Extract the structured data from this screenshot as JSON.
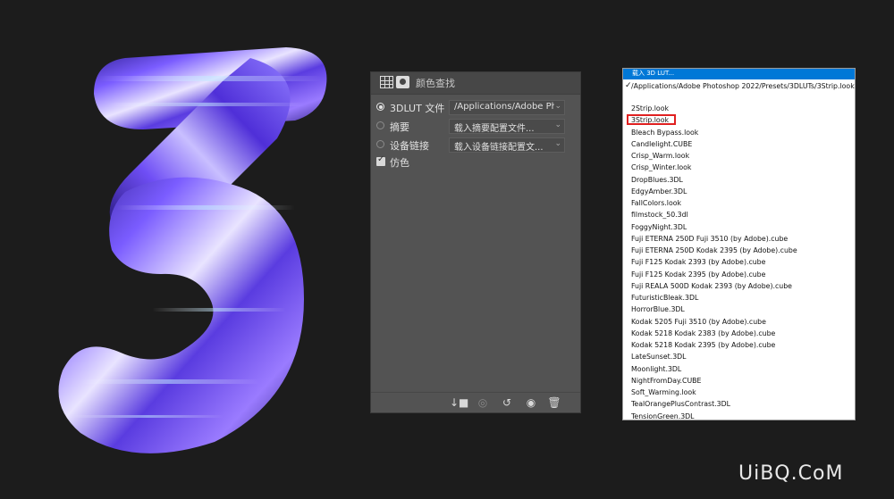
{
  "panel": {
    "title": "颜色查找",
    "rows": [
      {
        "label": "3DLUT 文件",
        "value": "/Applications/Adobe  Pho...",
        "selected": true
      },
      {
        "label": "摘要",
        "value": "载入摘要配置文件...",
        "selected": false
      },
      {
        "label": "设备链接",
        "value": "载入设备链接配置文...",
        "selected": false
      }
    ],
    "dither_label": "仿色",
    "dither_checked": true
  },
  "dropdown": {
    "selected_header": "载入 3D LUT...",
    "current_path": "/Applications/Adobe Photoshop 2022/Presets/3DLUTs/3Strip.look",
    "items": [
      "2Strip.look",
      "3Strip.look",
      "Bleach Bypass.look",
      "Candlelight.CUBE",
      "Crisp_Warm.look",
      "Crisp_Winter.look",
      "DropBlues.3DL",
      "EdgyAmber.3DL",
      "FallColors.look",
      "filmstock_50.3dl",
      "FoggyNight.3DL",
      "Fuji ETERNA 250D Fuji 3510 (by Adobe).cube",
      "Fuji ETERNA 250D Kodak 2395 (by Adobe).cube",
      "Fuji F125 Kodak 2393 (by Adobe).cube",
      "Fuji F125 Kodak 2395 (by Adobe).cube",
      "Fuji REALA 500D Kodak 2393 (by Adobe).cube",
      "FuturisticBleak.3DL",
      "HorrorBlue.3DL",
      "Kodak 5205 Fuji 3510 (by Adobe).cube",
      "Kodak 5218 Kodak 2383 (by Adobe).cube",
      "Kodak 5218 Kodak 2395 (by Adobe).cube",
      "LateSunset.3DL",
      "Moonlight.3DL",
      "NightFromDay.CUBE",
      "Soft_Warming.look",
      "TealOrangePlusContrast.3DL",
      "TensionGreen.3DL"
    ],
    "highlighted_item": "3Strip.look"
  },
  "watermark": "UiBQ.CoM",
  "colors": {
    "accent": "#0078d7",
    "highlight_box": "#e02020",
    "panel_bg": "#535353"
  }
}
